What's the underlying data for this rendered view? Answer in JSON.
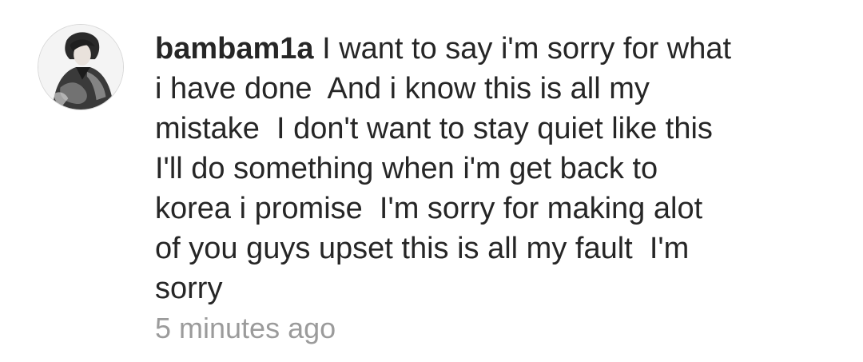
{
  "comment": {
    "username": "bambam1a",
    "text": "I want to say i'm sorry for what\ni have done  And i know this is all my\nmistake  I don't want to stay quiet like this\nI'll do something when i'm get back to\nkorea i promise  I'm sorry for making alot\nof you guys upset this is all my fault  I'm\nsorry",
    "timestamp": "5 minutes ago"
  },
  "colors": {
    "text": "#262626",
    "timestamp": "#9b9b9b",
    "background": "#ffffff",
    "avatar_border": "#d8d8d8"
  }
}
